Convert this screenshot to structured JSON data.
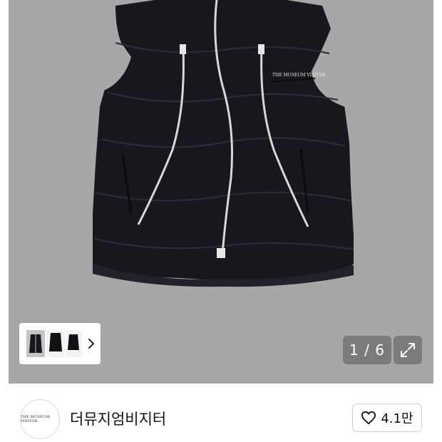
{
  "gallery": {
    "counter": "1 / 6",
    "product_image_text": "THE MUSEUM VISITOR",
    "thumbnail_chevron_icon": "chevron-right-icon",
    "expand_icon": "expand-arrows-icon",
    "colors": {
      "photo_bg": "#a7a7a7",
      "vest": "#17181d",
      "zipper": "#d8d8d8"
    }
  },
  "seller": {
    "avatar_text": "THE MUSEUM VISITOR",
    "name": "더뮤지엄비지터",
    "like_icon": "heart-outline-icon",
    "like_count": "4.1만"
  }
}
